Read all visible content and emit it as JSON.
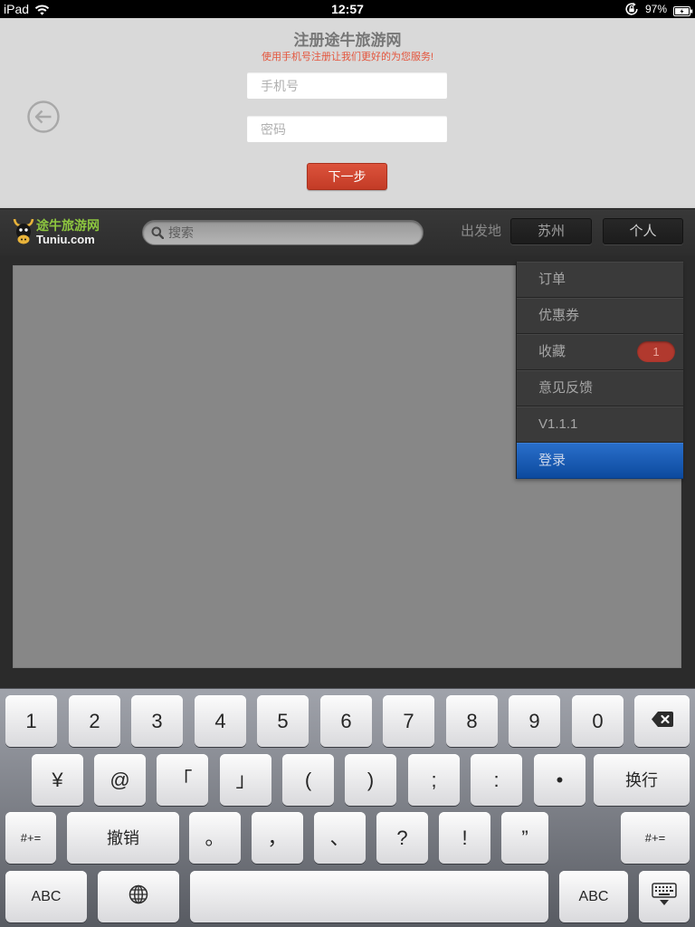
{
  "status_bar": {
    "device": "iPad",
    "time": "12:57",
    "battery": "97%",
    "icons": [
      "wifi-icon",
      "rotation-lock-icon",
      "battery-icon"
    ]
  },
  "register": {
    "title": "注册途牛旅游网",
    "subtitle": "使用手机号注册让我们更好的为您服务!",
    "phone_placeholder": "手机号",
    "phone_value": "",
    "password_placeholder": "密码",
    "password_value": "",
    "next_label": "下一步",
    "back_icon": "back-arrow-icon"
  },
  "header": {
    "logo_cn": "途牛旅游网",
    "logo_en": "Tuniu.com",
    "logo_icon": "logo-cow-icon",
    "search_placeholder": "搜索",
    "search_icon": "search-icon",
    "departure_label": "出发地",
    "departure_city": "苏州",
    "personal_label": "个人"
  },
  "menu": {
    "items": [
      {
        "label": "订单"
      },
      {
        "label": "优惠券"
      },
      {
        "label": "收藏",
        "badge": "1"
      },
      {
        "label": "意见反馈"
      },
      {
        "label": "V1.1.1"
      },
      {
        "label": "登录",
        "selected": true
      }
    ]
  },
  "keyboard": {
    "row1": [
      "1",
      "2",
      "3",
      "4",
      "5",
      "6",
      "7",
      "8",
      "9",
      "0"
    ],
    "delete_icon": "delete-icon",
    "row2": [
      "¥",
      "@",
      "「",
      "」",
      "(",
      ")",
      ";",
      ":",
      "•"
    ],
    "return_label": "换行",
    "symbols_label": "#+=",
    "undo_label": "撤销",
    "row3": [
      "。",
      "，",
      "、",
      "?",
      "!",
      "”"
    ],
    "abc_label": "ABC",
    "globe_icon": "globe-icon",
    "dismiss_icon": "keyboard-dismiss-icon"
  },
  "colors": {
    "subtitle": "#e4553c",
    "next_button": "#cf4530",
    "menu_selected": "#1c5db5",
    "badge": "#b1392e",
    "logo_green": "#8dc63f",
    "content_area": "#878787"
  }
}
